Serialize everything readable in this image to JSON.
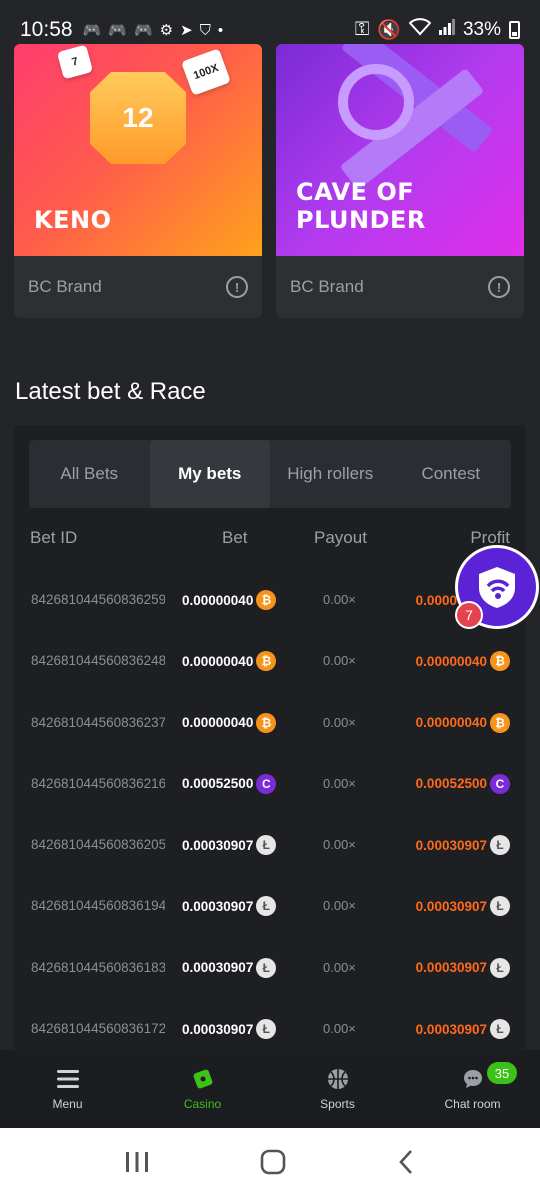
{
  "status_bar": {
    "time": "10:58",
    "battery": "33%",
    "left_icons": [
      "gamepad-icon",
      "gamepad-icon",
      "gamepad-icon",
      "gear-icon",
      "telegram-icon",
      "shield-wifi-icon",
      "dot-icon"
    ],
    "right_icons": [
      "key-icon",
      "mute-icon",
      "wifi-icon",
      "signal-icon",
      "battery-icon"
    ]
  },
  "cards": [
    {
      "title": "KENO",
      "provider": "BC Brand",
      "gem_number": "12",
      "dice": [
        "7",
        "100X"
      ]
    },
    {
      "title": "CAVE OF PLUNDER",
      "provider": "BC Brand"
    }
  ],
  "section": {
    "title": "Latest bet & Race"
  },
  "tabs": [
    {
      "label": "All Bets",
      "active": false
    },
    {
      "label": "My bets",
      "active": true
    },
    {
      "label": "High rollers",
      "active": false
    },
    {
      "label": "Contest",
      "active": false
    }
  ],
  "table": {
    "headers": {
      "bet_id": "Bet ID",
      "bet": "Bet",
      "payout": "Payout",
      "profit": "Profit"
    },
    "rows": [
      {
        "id": "842681044560836259",
        "bet": "0.00000040",
        "payout": "0.00×",
        "profit": "0.00000040",
        "coin": "btc"
      },
      {
        "id": "842681044560836248",
        "bet": "0.00000040",
        "payout": "0.00×",
        "profit": "0.00000040",
        "coin": "btc"
      },
      {
        "id": "842681044560836237",
        "bet": "0.00000040",
        "payout": "0.00×",
        "profit": "0.00000040",
        "coin": "btc"
      },
      {
        "id": "842681044560836216",
        "bet": "0.00052500",
        "payout": "0.00×",
        "profit": "0.00052500",
        "coin": "cc"
      },
      {
        "id": "842681044560836205",
        "bet": "0.00030907",
        "payout": "0.00×",
        "profit": "0.00030907",
        "coin": "ltc"
      },
      {
        "id": "842681044560836194",
        "bet": "0.00030907",
        "payout": "0.00×",
        "profit": "0.00030907",
        "coin": "ltc"
      },
      {
        "id": "842681044560836183",
        "bet": "0.00030907",
        "payout": "0.00×",
        "profit": "0.00030907",
        "coin": "ltc"
      },
      {
        "id": "842681044560836172",
        "bet": "0.00030907",
        "payout": "0.00×",
        "profit": "0.00030907",
        "coin": "ltc"
      }
    ]
  },
  "floating_button": {
    "badge": "7"
  },
  "bottom_nav": [
    {
      "label": "Menu",
      "icon": "menu-icon",
      "active": false
    },
    {
      "label": "Casino",
      "icon": "casino-icon",
      "active": true
    },
    {
      "label": "Sports",
      "icon": "basketball-icon",
      "active": false
    },
    {
      "label": "Chat room",
      "icon": "chat-icon",
      "active": false,
      "badge": "35"
    }
  ],
  "colors": {
    "accent_green": "#3bc117",
    "profit_orange": "#ff6a1a",
    "btc": "#f7931a",
    "cc": "#7b2bd9",
    "ltc": "#e6e6e6"
  }
}
